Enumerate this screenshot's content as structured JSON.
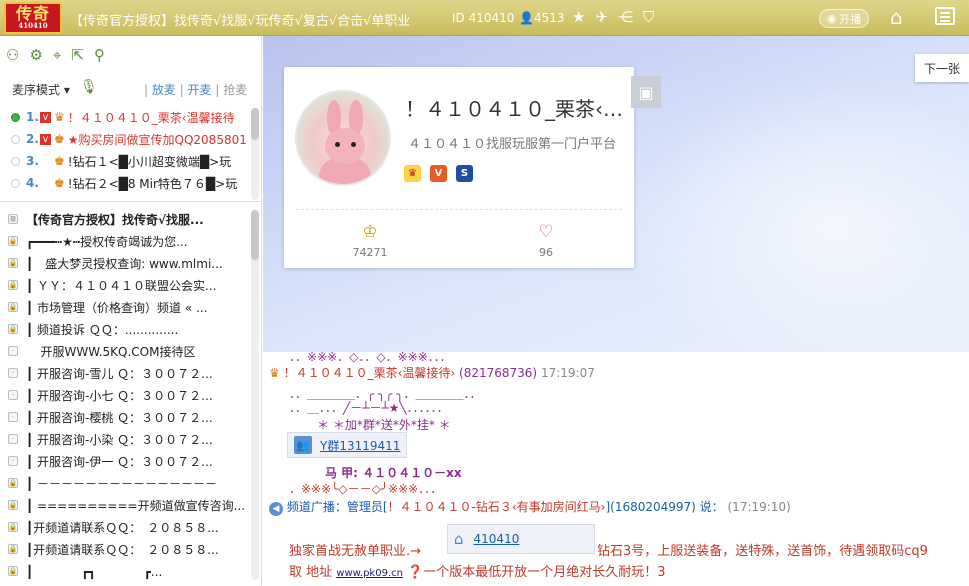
{
  "topbar": {
    "logo_big": "传奇",
    "logo_small": "410410",
    "title": "【传奇官方授权】找传奇√找服√玩传奇√复古√合击√单职业",
    "id_text": "ID 410410",
    "users_text": "4513",
    "live_label": "开播"
  },
  "left": {
    "mode_label": "麦序模式 ▾",
    "links": {
      "release": "放麦",
      "open": "开麦",
      "grab": "抢麦"
    },
    "mic_list": [
      {
        "num": "1.",
        "text": "！４１０４１０_栗茶‹温馨接待"
      },
      {
        "num": "2.",
        "text": "★购买房间做宣传加QQ2085801"
      },
      {
        "num": "3.",
        "text": "!钻石１<█小川超变微端█>玩"
      },
      {
        "num": "4.",
        "text": "!钻石２<█8 Mir特色７６█>玩"
      }
    ],
    "channels": [
      "【传奇官方授权】找传奇√找服...",
      "┏━━━┅★┅授权传奇竭诚为您...",
      "┃　盛大梦灵授权查询: www.mlmi...",
      "┃ ＹＹ：４１０４１０联盟公会实...",
      "┃ 市场管理（价格查询）频道 « ...",
      "┃ 频道投诉 ＱＱ：..............",
      "开服WWW.5KQ.COM接待区",
      "┃ 开服咨询-雪儿 Ｑ：３００７２...",
      "┃ 开服咨询-小七 Ｑ：３００７２...",
      "┃ 开服咨询-樱桃 Ｑ：３００７２...",
      "┃ 开服咨询-小染 Ｑ：３００７２...",
      "┃ 开服咨询-伊一 Ｑ：３００７２...",
      "┃ －－－－－－－－－－－－－－－",
      "┃ ==========开频道做宣传咨询...",
      "┃开频道请联系ＱＱ：　２０８５８...",
      "┃开频道请联系ＱＱ：　２０８５８...",
      "┃　　　　┏┓　　　　┏..."
    ]
  },
  "banner": {
    "next_label": "下一张",
    "card_name": "！４１０４１０_栗茶‹温...",
    "card_sub": "４１０４１０找服玩服第一门户平台",
    "stat1": "74271",
    "stat2": "96"
  },
  "chat": {
    "l0": "．．※※※．◇．．◇．※※※．．．",
    "l1_name": "！４１０４１０_栗茶‹温馨接待›",
    "l1_id": "(821768736)",
    "l1_time": "17:19:07",
    "l2": "．．＿＿＿＿．╭ ╮╭ ╮．＿＿＿＿．．",
    "l3": "．．＿．．．╱－┴－┴★╲．．．．．．",
    "l4": "＊ ＊加*群*送*外*挂* ＊",
    "l5_link": "Y群13119411",
    "l6": "马 甲: ４１０４１０－xx",
    "l7": "．※※※╰◇－－◇╯※※※．．．",
    "l8_prefix": "频道广播：管理员[",
    "l8_name": "！４１０４１０-钻石３‹有事加房间红马›",
    "l8_id": "](1680204997) 说：",
    "l8_time": "(17:19:10)",
    "l9_a": "独家首战无赦单职业.→",
    "l9_link": "410410",
    "l9_b": "钻石3号，上服送装备，送特殊，送首饰，待遇领取码cq9",
    "l10_a": "取 地址",
    "l10_link": "www.pk09.cn",
    "l10_b": "一个版本最低开放一个月绝对长久耐玩！3"
  }
}
